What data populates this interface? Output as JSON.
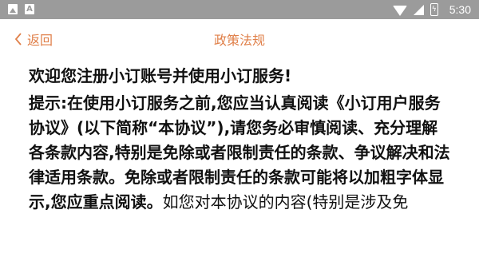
{
  "status_bar": {
    "time": "5:30",
    "left_icons": [
      "image-notification-icon",
      "font-notification-icon"
    ],
    "right_icons": [
      "wifi-icon",
      "cell-signal-icon",
      "battery-icon"
    ]
  },
  "header": {
    "back_label": "返回",
    "title": "政策法规"
  },
  "content": {
    "heading": "欢迎您注册小订账号并使用小订服务!",
    "bold_text": "提示:在使用小订服务之前,您应当认真阅读《小订用户服务协议》(以下简称“本协议”),请您务必审慎阅读、充分理解各条款内容,特别是免除或者限制责任的条款、争议解决和法律适用条款。免除或者限制责任的条款可能将以加粗字体显示,您应重点阅读。",
    "normal_text": "如您对本协议的内容(特别是涉及免"
  },
  "colors": {
    "accent": "#e0804a",
    "status_bar": "#9b9b9b",
    "text": "#111111"
  }
}
